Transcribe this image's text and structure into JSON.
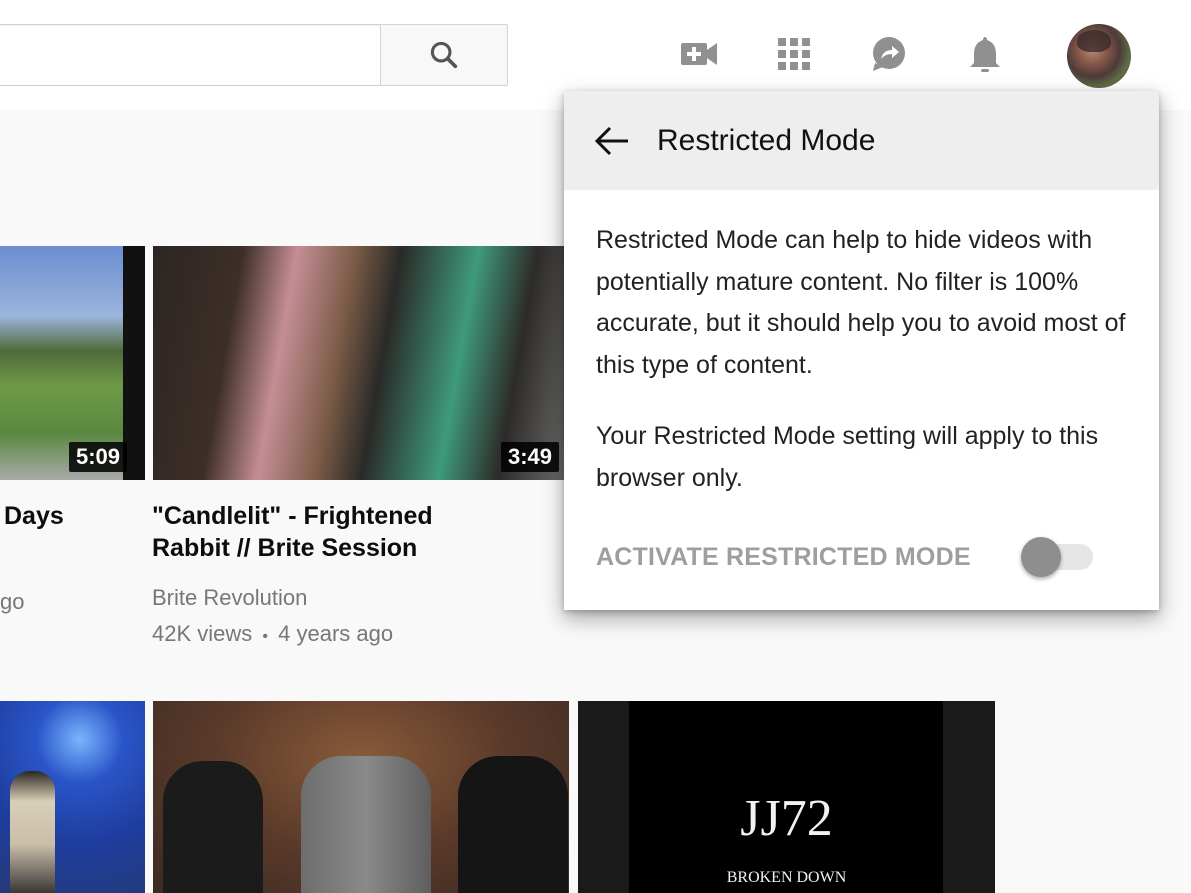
{
  "masthead": {
    "search": {
      "value": "",
      "placeholder": ""
    },
    "icons": [
      "create-video-icon",
      "apps-grid-icon",
      "share-messages-icon",
      "notifications-bell-icon"
    ],
    "avatar_label": "Account"
  },
  "videos": [
    {
      "title_fragment": "Days",
      "meta_fragment": "go",
      "duration": "5:09"
    },
    {
      "title": "\"Candlelit\" - Frightened Rabbit // Brite Session",
      "title_line1": "\"Candlelit\" - Frightened",
      "title_line2": "Rabbit // Brite Session",
      "channel": "Brite Revolution",
      "views": "42K views",
      "separator": "•",
      "age": "4 years ago",
      "duration": "3:49"
    },
    {
      "thumb_text": "",
      "duration": ""
    },
    {
      "thumb_text": ""
    },
    {
      "thumb_title": "JJ72",
      "thumb_subtitle": "BROKEN DOWN"
    }
  ],
  "restricted_popup": {
    "title": "Restricted Mode",
    "paragraph1": "Restricted Mode can help to hide videos with potentially mature content. No filter is 100% accurate, but it should help you to avoid most of this type of content.",
    "paragraph2": "Your Restricted Mode setting will apply to this browser only.",
    "toggle_label": "ACTIVATE RESTRICTED MODE",
    "toggle_on": false
  },
  "colors": {
    "header_bg": "#eeeeee",
    "toggle_knob_off": "#8e8e8e",
    "toggle_track_off": "#e6e6e6",
    "label_disabled": "#9e9e9e"
  }
}
